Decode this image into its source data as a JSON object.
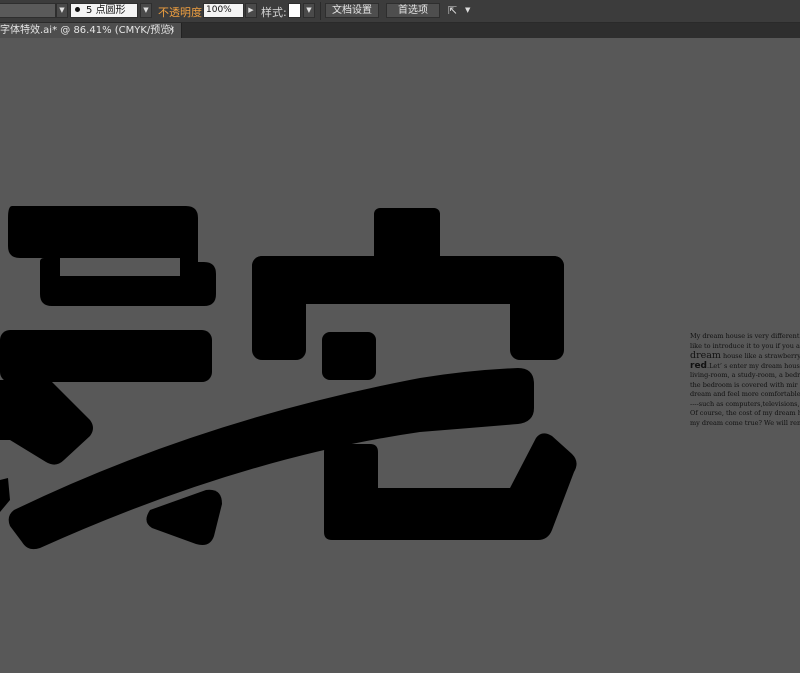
{
  "control_bar": {
    "brush_size": "5",
    "brush_shape": "点圆形",
    "opacity_label": "不透明度",
    "opacity_value": "100%",
    "style_label": "样式:",
    "doc_setup_button": "文档设置",
    "preferences_button": "首选项",
    "more_icon": "arrange-icon"
  },
  "document_tab": {
    "title": "字体特效.ai* @ 86.41% (CMYK/预览)",
    "close": "×"
  },
  "artboard_text": {
    "line1": "My dream house is very different",
    "line2": "like to introduce it to you if you a",
    "line3_word": "dream",
    "line3_rest": " house like a strawberry",
    "line4_word": "red",
    "line4_rest": ".Let’  s enter my dream house",
    "line5": "living-room, a study-room, a bedr",
    "line6": "the bedroom is covered with mir",
    "line7": "dream and feel more comfortable T",
    "line8": "----such as computers,televisions, t",
    "line9": "Of course, the cost of my dream ho",
    "line10": "my dream come true? We will rema"
  },
  "colors": {
    "canvas": "#585858",
    "artwork": "#000000",
    "opacity_label": "#f0a040"
  }
}
